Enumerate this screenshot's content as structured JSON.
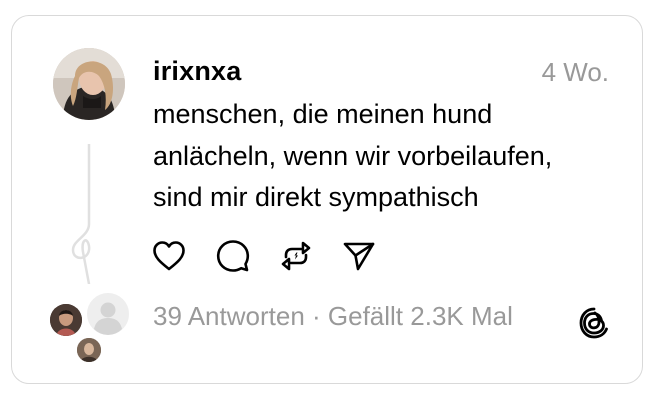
{
  "post": {
    "username": "irixnxa",
    "timestamp": "4 Wo.",
    "text_lines": [
      "menschen, die meinen hund",
      "anlächeln, wenn wir vorbeilaufen,",
      "sind mir direkt sympathisch"
    ]
  },
  "actions": {
    "like": "heart-icon",
    "reply": "comment-bubble-icon",
    "repost": "repost-icon",
    "share": "send-icon"
  },
  "footer": {
    "replies": "39 Antworten",
    "separator": " · ",
    "likes": "Gefällt 2.3K Mal",
    "logo": "threads-logo-icon"
  },
  "colors": {
    "text": "#000000",
    "muted": "#999999",
    "border": "#d9d9d9"
  }
}
